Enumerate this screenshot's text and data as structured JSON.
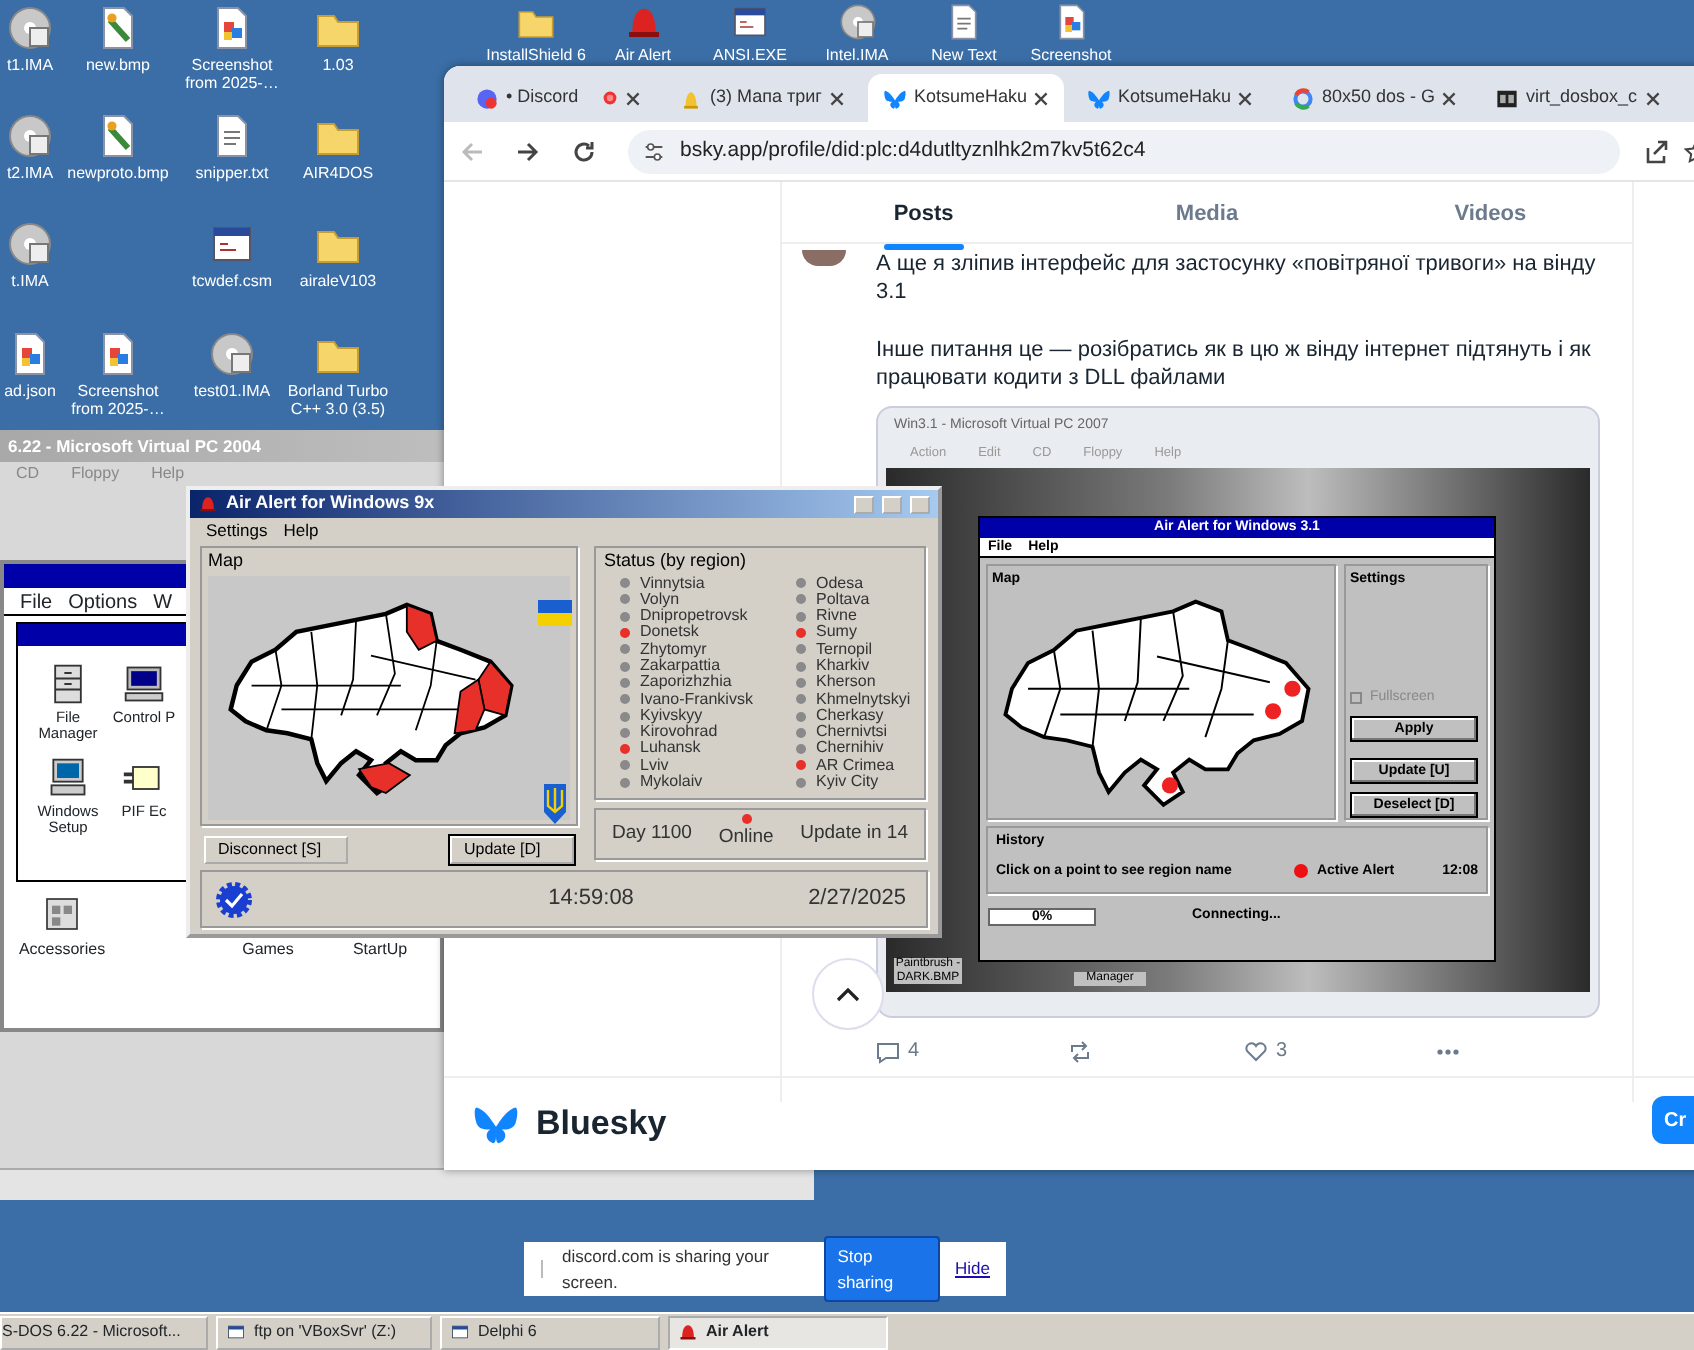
{
  "desktop_icons": [
    {
      "label": "t1.IMA",
      "kind": "disc"
    },
    {
      "label": "new.bmp",
      "kind": "picture"
    },
    {
      "label": "Screenshot from 2025-…",
      "kind": "screenshot"
    },
    {
      "label": "1.03",
      "kind": "folder"
    },
    {
      "label": "t2.IMA",
      "kind": "disc"
    },
    {
      "label": "newproto.bmp",
      "kind": "picture"
    },
    {
      "label": "snipper.txt",
      "kind": "text"
    },
    {
      "label": "AIR4DOS",
      "kind": "folder"
    },
    {
      "label": "t.IMA",
      "kind": "disc"
    },
    {
      "label": "tcwdef.csm",
      "kind": "app"
    },
    {
      "label": "airaleV103",
      "kind": "folder"
    },
    {
      "label": "ad.json",
      "kind": "screenshot"
    },
    {
      "label": "Screenshot from 2025-…",
      "kind": "screenshot"
    },
    {
      "label": "test01.IMA",
      "kind": "disc"
    },
    {
      "label": "Borland Turbo C++ 3.0 (3.5)",
      "kind": "folder"
    }
  ],
  "top_icons": [
    {
      "label": "InstallShield 6",
      "kind": "folder"
    },
    {
      "label": "Air Alert",
      "kind": "alarm"
    },
    {
      "label": "ANSI.EXE",
      "kind": "app"
    },
    {
      "label": "Intel.IMA",
      "kind": "disc"
    },
    {
      "label": "New Text",
      "kind": "text"
    },
    {
      "label": "Screenshot",
      "kind": "screenshot"
    }
  ],
  "vpc_window": {
    "title": "6.22 - Microsoft Virtual PC 2004",
    "menu": [
      "CD",
      "Floppy",
      "Help"
    ],
    "program_manager": {
      "menu": [
        "File",
        "Options",
        "W"
      ],
      "icons": [
        {
          "label": "File Manager",
          "kind": "cabinet"
        },
        {
          "label": "Control P",
          "kind": "computer"
        },
        {
          "label": "Windows Setup",
          "kind": "setup"
        },
        {
          "label": "PIF Ec",
          "kind": "pif"
        }
      ],
      "groups": [
        "Accessories",
        "Games",
        "StartUp"
      ]
    }
  },
  "browser": {
    "tabs": [
      {
        "label": "• Discord",
        "kind": "discord",
        "selected": false
      },
      {
        "label": "(3) Мапа триг",
        "kind": "map",
        "selected": false
      },
      {
        "label": "KotsumeHaku",
        "kind": "bluesky",
        "selected": true
      },
      {
        "label": "KotsumeHaku",
        "kind": "bluesky",
        "selected": false
      },
      {
        "label": "80x50 dos - G",
        "kind": "google",
        "selected": false
      },
      {
        "label": "virt_dosbox_c",
        "kind": "dosbox",
        "selected": false
      }
    ],
    "url": "bsky.app/profile/did:plc:d4dutltyznlhk2m7kv5t62c4",
    "profile_tabs": [
      {
        "label": "Posts",
        "selected": true
      },
      {
        "label": "Media",
        "selected": false
      },
      {
        "label": "Videos",
        "selected": false
      }
    ],
    "post": {
      "paragraphs": [
        "А ще я зліпив інтерфейс для застосунку «повітряної тривоги» на вінду 3.1",
        "Інше питання це  —  розібратись як в цю ж вінду інтернет підтянуть і як працювати кодити з DLL файлами"
      ],
      "image": {
        "window_title": "Win3.1 - Microsoft Virtual PC 2007",
        "menu": [
          "Action",
          "Edit",
          "CD",
          "Floppy",
          "Help"
        ],
        "app": {
          "title": "Air Alert for Windows 3.1",
          "menu": [
            "File",
            "Help"
          ],
          "map_label": "Map",
          "settings_label": "Settings",
          "fullscreen": {
            "label": "Fullscreen",
            "checked": false,
            "disabled": true
          },
          "buttons": [
            "Apply",
            "Update [U]",
            "Deselect [D]"
          ],
          "history": {
            "title": "History",
            "hint": "Click on a point to see region name",
            "legend": "Active Alert",
            "time": "12:08"
          },
          "progress": {
            "level": 0,
            "label": "0%"
          },
          "status": "Connecting..."
        },
        "desktop_labels": [
          "Paintbrush - DARK.BMP",
          "Manager"
        ]
      },
      "replies": "4",
      "likes": "3"
    },
    "footer": {
      "brand": "Bluesky",
      "button": "Cr"
    }
  },
  "air_alert": {
    "title": "Air Alert for Windows 9x",
    "menu": [
      "Settings",
      "Help"
    ],
    "map_label": "Map",
    "status_label": "Status (by region)",
    "regions": [
      {
        "name": "Vinnytsia",
        "alert": false
      },
      {
        "name": "Volyn",
        "alert": false
      },
      {
        "name": "Dnipropetrovsk",
        "alert": false
      },
      {
        "name": "Donetsk",
        "alert": true
      },
      {
        "name": "Zhytomyr",
        "alert": false
      },
      {
        "name": "Zakarpattia",
        "alert": false
      },
      {
        "name": "Zaporizhzhia",
        "alert": false
      },
      {
        "name": "Ivano-Frankivsk",
        "alert": false
      },
      {
        "name": "Kyivskyy",
        "alert": false
      },
      {
        "name": "Kirovohrad",
        "alert": false
      },
      {
        "name": "Luhansk",
        "alert": true
      },
      {
        "name": "Lviv",
        "alert": false
      },
      {
        "name": "Mykolaiv",
        "alert": false
      },
      {
        "name": "Odesa",
        "alert": false
      },
      {
        "name": "Poltava",
        "alert": false
      },
      {
        "name": "Rivne",
        "alert": false
      },
      {
        "name": "Sumy",
        "alert": true
      },
      {
        "name": "Ternopil",
        "alert": false
      },
      {
        "name": "Kharkiv",
        "alert": false
      },
      {
        "name": "Kherson",
        "alert": false
      },
      {
        "name": "Khmelnytskyi",
        "alert": false
      },
      {
        "name": "Cherkasy",
        "alert": false
      },
      {
        "name": "Chernivtsi",
        "alert": false
      },
      {
        "name": "Chernihiv",
        "alert": false
      },
      {
        "name": "AR Crimea",
        "alert": true
      },
      {
        "name": "Kyiv City",
        "alert": false
      }
    ],
    "buttons": [
      "Disconnect [S]",
      "Update [D]"
    ],
    "day": "Day 1100",
    "online": "Online",
    "update_in": "Update in 14",
    "time": "14:59:08",
    "date": "2/27/2025"
  },
  "sharing_bar": {
    "message": "discord.com is sharing your screen.",
    "stop": "Stop sharing",
    "hide": "Hide"
  },
  "taskbar": [
    {
      "label": "S-DOS 6.22 - Microsoft...",
      "selected": false
    },
    {
      "label": "ftp on 'VBoxSvr' (Z:)",
      "selected": false
    },
    {
      "label": "Delphi 6",
      "selected": false
    },
    {
      "label": "Air Alert",
      "selected": true
    }
  ]
}
